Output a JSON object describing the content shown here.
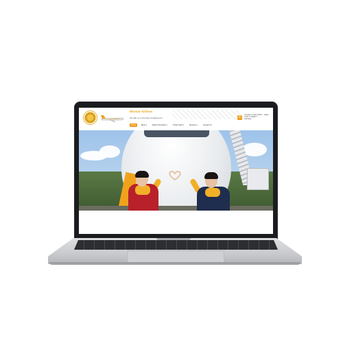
{
  "site": {
    "brand": "Bhutan Airlines",
    "tagline": "Fly with us to the land of happiness!",
    "contact_line1": "Contact us Now 24/hrs · 7days",
    "contact_line2": "+975 77 000077",
    "contact_line3": "Call Now",
    "nav": [
      "Home",
      "Book",
      "Flight Information",
      "Travel Tools",
      "Services",
      "Contact Us"
    ],
    "nav_dropdown_marks": [
      "",
      "▾",
      "▾",
      "▾",
      "▾",
      ""
    ]
  },
  "icons": {
    "emblem": "emblem-icon",
    "plane": "airplane-logo-icon",
    "phone": "phone-icon"
  },
  "colors": {
    "accent": "#f09a1a",
    "brand": "#e8a81e",
    "laptop_bezel": "#1b1c1f",
    "laptop_body": "#c9cacd"
  }
}
